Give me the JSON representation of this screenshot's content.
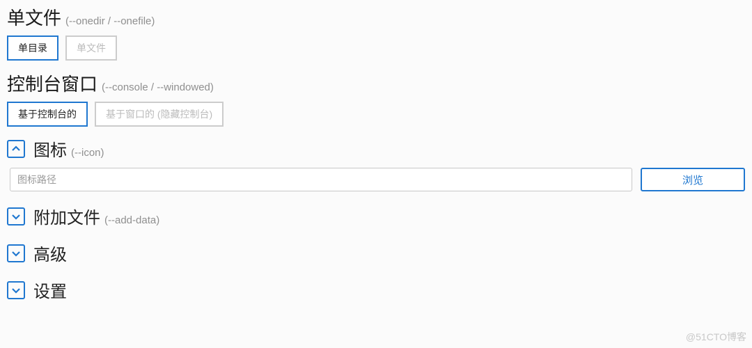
{
  "single_file": {
    "title": "单文件",
    "hint": "(--onedir / --onefile)",
    "options": {
      "onedir": "单目录",
      "onefile": "单文件"
    },
    "selected": "onedir"
  },
  "console_window": {
    "title": "控制台窗口",
    "hint": "(--console / --windowed)",
    "options": {
      "console": "基于控制台的",
      "windowed": "基于窗口的 (隐藏控制台)"
    },
    "selected": "console"
  },
  "icon": {
    "title": "图标",
    "hint": "(--icon)",
    "expanded": true,
    "path_value": "",
    "path_placeholder": "图标路径",
    "browse_label": "浏览"
  },
  "add_data": {
    "title": "附加文件",
    "hint": "(--add-data)",
    "expanded": false
  },
  "advanced": {
    "title": "高级",
    "expanded": false
  },
  "settings": {
    "title": "设置",
    "expanded": false
  },
  "colors": {
    "accent": "#1f77d0"
  },
  "watermark": "@51CTO博客"
}
